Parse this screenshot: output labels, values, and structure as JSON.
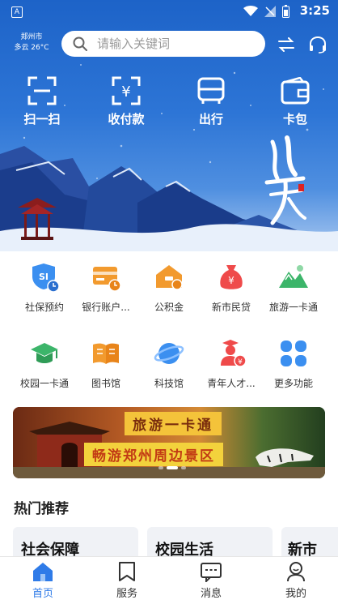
{
  "status_bar": {
    "time": "3:25",
    "app_badge": "A"
  },
  "weather": {
    "city": "郑州市",
    "condition": "多云 26°C"
  },
  "search": {
    "placeholder": "请输入关键词"
  },
  "quick_actions": [
    {
      "label": "扫一扫",
      "icon": "scan-icon"
    },
    {
      "label": "收付款",
      "icon": "payment-icon"
    },
    {
      "label": "出行",
      "icon": "bus-icon"
    },
    {
      "label": "卡包",
      "icon": "wallet-icon"
    }
  ],
  "services_row1": [
    {
      "label": "社保预约",
      "icon": "social-security-icon",
      "color": "#3b8ff0"
    },
    {
      "label": "银行账户...",
      "icon": "bank-card-icon",
      "color": "#f29a2e"
    },
    {
      "label": "公积金",
      "icon": "housing-fund-icon",
      "color": "#f29a2e"
    },
    {
      "label": "新市民贷",
      "icon": "loan-bag-icon",
      "color": "#ef4a4a"
    },
    {
      "label": "旅游一卡通",
      "icon": "mountain-icon",
      "color": "#3cb56a"
    }
  ],
  "services_row2": [
    {
      "label": "校园一卡通",
      "icon": "graduation-cap-icon",
      "color": "#3cb56a"
    },
    {
      "label": "图书馆",
      "icon": "book-icon",
      "color": "#f29a2e"
    },
    {
      "label": "科技馆",
      "icon": "planet-icon",
      "color": "#3b8ff0"
    },
    {
      "label": "青年人才...",
      "icon": "talent-icon",
      "color": "#ef4a4a"
    },
    {
      "label": "更多功能",
      "icon": "more-grid-icon",
      "color": "#3b8ff0"
    }
  ],
  "banner": {
    "title": "旅游一卡通",
    "subtitle": "畅游郑州周边景区"
  },
  "hot": {
    "title": "热门推荐",
    "cards": [
      "社会保障",
      "校园生活",
      "新市"
    ]
  },
  "tabs": [
    {
      "label": "首页",
      "icon": "home-icon",
      "active": true
    },
    {
      "label": "服务",
      "icon": "bookmark-icon",
      "active": false
    },
    {
      "label": "消息",
      "icon": "message-icon",
      "active": false
    },
    {
      "label": "我的",
      "icon": "profile-icon",
      "active": false
    }
  ],
  "colors": {
    "primary": "#2f7be8",
    "hero_top": "#1d63c8"
  }
}
